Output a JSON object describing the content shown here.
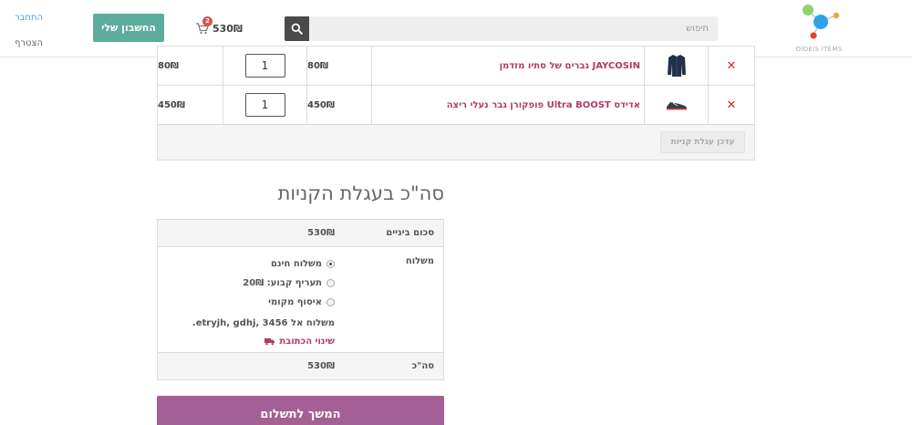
{
  "header": {
    "login_label": "התחבר",
    "register_label": "הצטרף",
    "account_button": "החשבון שלי",
    "cart_count": "2",
    "cart_total": "530₪",
    "search_placeholder": "חיפוש",
    "logo_text": "OIDEIS ITEMS"
  },
  "cart": {
    "items": [
      {
        "name": "JAYCOSIN גברים של סתיו מזדמן",
        "price": "80₪",
        "quantity": "1",
        "subtotal": "80₪"
      },
      {
        "name": "אדידס Ultra BOOST פופקורן גבר נעלי ריצה",
        "price": "450₪",
        "quantity": "1",
        "subtotal": "450₪"
      }
    ],
    "remove_symbol": "✕",
    "update_button": "עדכן עגלת קניות"
  },
  "totals": {
    "title": "סה\"כ בעגלת הקניות",
    "subtotal_label": "סכום ביניים",
    "subtotal_value": "530₪",
    "shipping_label": "משלוח",
    "shipping_options": [
      {
        "label": "משלוח חינם",
        "checked": true
      },
      {
        "label": "תעריף קבוע: 20₪",
        "checked": false
      },
      {
        "label": "איסוף מקומי",
        "checked": false
      }
    ],
    "shipping_destination": "משלוח אל etryjh, gdhj, 3456.",
    "change_address": "שינוי הכתובת",
    "total_label": "סה\"כ",
    "total_value": "530₪"
  },
  "checkout_button": "המשך לתשלום",
  "colors": {
    "accent_green": "#5cad9b",
    "accent_purple": "#a45f96",
    "link_magenta": "#b03a6a",
    "remove_red": "#d12c2c"
  }
}
